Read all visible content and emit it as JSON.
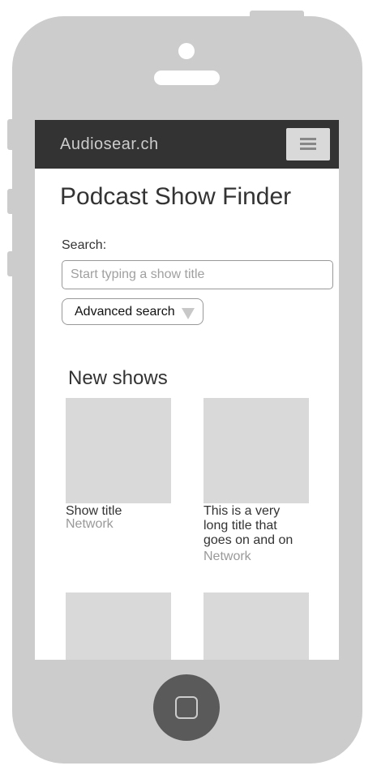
{
  "header": {
    "brand": "Audiosear.ch",
    "menu_icon": "hamburger-menu-icon"
  },
  "main": {
    "title": "Podcast Show Finder",
    "search": {
      "label": "Search:",
      "placeholder": "Start typing a show title",
      "value": ""
    },
    "advanced_search": {
      "label": "Advanced search",
      "icon": "triangle-down-icon"
    }
  },
  "new_shows": {
    "heading": "New shows",
    "items": [
      {
        "title": "Show title",
        "network": "Network"
      },
      {
        "title": "This is a very long title that goes on and on",
        "network": "Network"
      },
      {
        "title": "",
        "network": ""
      },
      {
        "title": "",
        "network": ""
      }
    ]
  },
  "device": {
    "home_button_icon": "home-square-icon"
  },
  "colors": {
    "navbar": "#333333",
    "device_body": "#cccccc",
    "placeholder_tile": "#d9d9d9",
    "muted_text": "#999999"
  }
}
